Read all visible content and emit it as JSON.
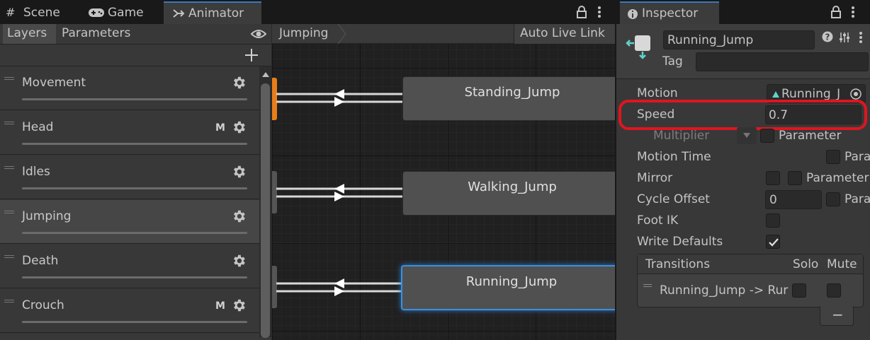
{
  "tabs": {
    "scene": "Scene",
    "game": "Game",
    "animator": "Animator",
    "inspector": "Inspector"
  },
  "animator": {
    "subtabs": [
      "Layers",
      "Parameters"
    ],
    "breadcrumb": "Jumping",
    "auto_live_link": "Auto Live Link",
    "layers": [
      {
        "name": "Movement",
        "badge": ""
      },
      {
        "name": "Head",
        "badge": "M"
      },
      {
        "name": "Idles",
        "badge": ""
      },
      {
        "name": "Jumping",
        "badge": ""
      },
      {
        "name": "Death",
        "badge": ""
      },
      {
        "name": "Crouch",
        "badge": "M"
      }
    ],
    "states": [
      "Standing_Jump",
      "Walking_Jump",
      "Running_Jump"
    ],
    "selected_state": "Running_Jump",
    "selected_layer": "Jumping"
  },
  "inspector": {
    "state_name": "Running_Jump",
    "tag_label": "Tag",
    "tag_value": "",
    "motion_label": "Motion",
    "motion_value": "Running_J",
    "speed_label": "Speed",
    "speed_value": "0.7",
    "multiplier_label": "Multiplier",
    "parameter_label": "Parameter",
    "motion_time_label": "Motion Time",
    "para_label": "Para",
    "mirror_label": "Mirror",
    "cycle_offset_label": "Cycle Offset",
    "cycle_offset_value": "0",
    "foot_ik_label": "Foot IK",
    "write_defaults_label": "Write Defaults",
    "write_defaults_checked": true,
    "transitions_header": "Transitions",
    "solo_label": "Solo",
    "mute_label": "Mute",
    "transition_item": "Running_Jump -> Rur",
    "remove_button": "−"
  },
  "colors": {
    "accent": "#3a79bb",
    "highlight": "#e0151f",
    "orange": "#e87e1a"
  }
}
